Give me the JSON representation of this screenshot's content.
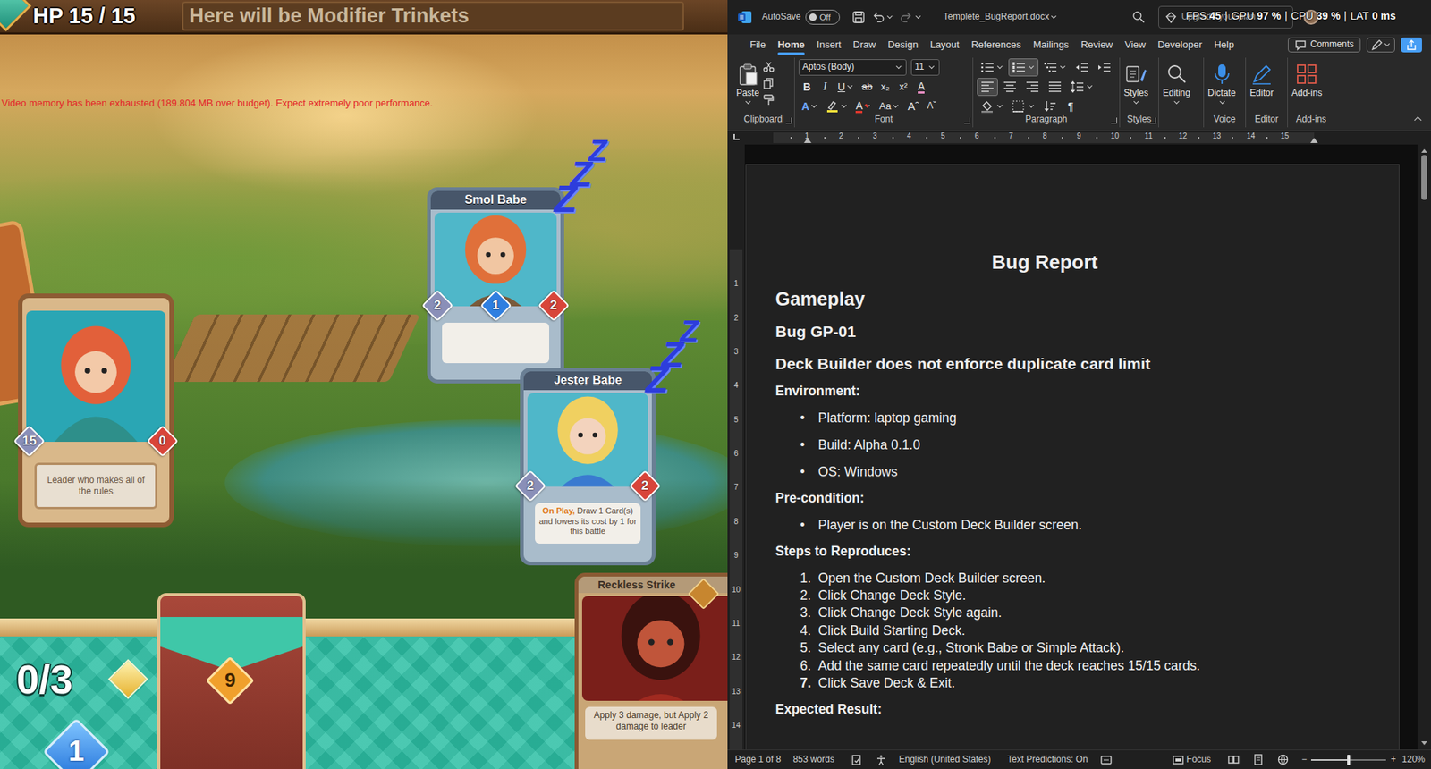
{
  "game": {
    "hp": "HP 15 / 15",
    "trinkets": "Here will be Modifier Trinkets",
    "warning": "Video memory has been exhausted (189.804 MB over budget). Expect extremely poor performance.",
    "leader": {
      "left": "15",
      "right": "0",
      "text": "Leader who makes all of the rules"
    },
    "board": [
      {
        "name": "Smol Babe",
        "left": "2",
        "cost": "1",
        "right": "2",
        "asleep": true
      },
      {
        "name": "Jester Babe",
        "left": "2",
        "right": "2",
        "keyword": "On Play,",
        "text": "Draw 1 Card(s) and lowers its cost by 1 for this battle",
        "asleep": true
      }
    ],
    "sleep_icon": "Z",
    "hand_card": {
      "name": "Reckless Strike",
      "text": "Apply 3 damage, but Apply 2 damage to leader"
    },
    "mana": "0/3",
    "deck_count": "9",
    "energy": "1"
  },
  "word": {
    "title_bar": {
      "autosave": "AutoSave",
      "autosave_state": "Off",
      "autosave_on": false,
      "filename": "Templete_BugReport.docx",
      "upgrade": "Upgrade your plan"
    },
    "overlay": {
      "separator": "|",
      "items": [
        {
          "label": "FPS",
          "value": "45"
        },
        {
          "label": "GPU",
          "value": "97 %"
        },
        {
          "label": "CPU",
          "value": "39 %"
        },
        {
          "label": "LAT",
          "value": "0 ms"
        }
      ]
    },
    "tabs": [
      {
        "label": "File",
        "selected": false
      },
      {
        "label": "Home",
        "selected": true
      },
      {
        "label": "Insert",
        "selected": false
      },
      {
        "label": "Draw",
        "selected": false
      },
      {
        "label": "Design",
        "selected": false
      },
      {
        "label": "Layout",
        "selected": false
      },
      {
        "label": "References",
        "selected": false
      },
      {
        "label": "Mailings",
        "selected": false
      },
      {
        "label": "Review",
        "selected": false
      },
      {
        "label": "View",
        "selected": false
      },
      {
        "label": "Developer",
        "selected": false
      },
      {
        "label": "Help",
        "selected": false
      }
    ],
    "comments": "Comments",
    "ribbon": {
      "clipboard": {
        "paste": "Paste",
        "label": "Clipboard"
      },
      "font": {
        "name": "Aptos (Body)",
        "size": "11",
        "label": "Font",
        "format": [
          {
            "kind": "bold",
            "label": "B"
          },
          {
            "kind": "italic",
            "label": "I"
          },
          {
            "kind": "underline",
            "label": "U"
          },
          {
            "kind": "strike",
            "label": "ab"
          },
          {
            "kind": "sub",
            "label": "x₂"
          },
          {
            "kind": "sup",
            "label": "x²"
          },
          {
            "kind": "clear",
            "label": "A"
          }
        ],
        "effects": [
          {
            "kind": "effects",
            "label": "A"
          },
          {
            "kind": "highlight"
          },
          {
            "kind": "color",
            "label": "A"
          },
          {
            "kind": "case",
            "label": "Aa"
          },
          {
            "kind": "grow",
            "label": "Aˆ"
          },
          {
            "kind": "shrink",
            "label": "Aˇ"
          }
        ]
      },
      "paragraph": {
        "label": "Paragraph",
        "rows": [
          [
            {
              "kind": "bullets",
              "selected": false
            },
            {
              "kind": "numbering",
              "selected": true
            },
            {
              "kind": "multilevel",
              "selected": false
            },
            {
              "kind": "outdent",
              "selected": false
            },
            {
              "kind": "indent",
              "selected": false
            }
          ],
          [
            {
              "kind": "align-left",
              "selected": true
            },
            {
              "kind": "align-center",
              "selected": false
            },
            {
              "kind": "align-right",
              "selected": false
            },
            {
              "kind": "justify",
              "selected": false
            },
            {
              "kind": "line-spacing",
              "selected": false
            }
          ],
          [
            {
              "kind": "shading",
              "selected": false
            },
            {
              "kind": "borders",
              "selected": false
            },
            {
              "kind": "sort",
              "selected": false
            },
            {
              "kind": "marks",
              "label": "¶",
              "selected": false
            }
          ]
        ]
      },
      "styles": {
        "button": "Styles",
        "label": "Styles"
      },
      "editing": {
        "button": "Editing"
      },
      "voice": {
        "button": "Dictate",
        "label": "Voice"
      },
      "editor": {
        "button": "Editor",
        "label": "Editor"
      },
      "addins": {
        "button": "Add-ins",
        "label": "Add-ins"
      }
    },
    "ruler": {
      "horizontal": [
        "1",
        "2",
        "3",
        "4",
        "5",
        "6",
        "7",
        "8",
        "9",
        "10",
        "11",
        "12",
        "13",
        "14",
        "15"
      ],
      "vertical": [
        "1",
        "2",
        "3",
        "4",
        "5",
        "6",
        "7",
        "8",
        "9",
        "10",
        "11",
        "12",
        "13",
        "14"
      ]
    },
    "document": {
      "title": "Bug Report",
      "section": "Gameplay",
      "bug_id": "Bug GP-01",
      "bug_title": "Deck Builder does not enforce duplicate card limit",
      "bullet": "•",
      "environment_label": "Environment:",
      "environment": [
        "Platform: laptop gaming",
        "Build: Alpha 0.1.0",
        "OS: Windows"
      ],
      "precondition_label": "Pre-condition:",
      "precondition": [
        "Player is on the Custom Deck Builder screen."
      ],
      "steps_label": "Steps to Reproduces:",
      "steps": [
        {
          "number": "1.",
          "text": "Open the Custom Deck Builder screen.",
          "bold": false
        },
        {
          "number": "2.",
          "text": "Click Change Deck Style.",
          "bold": false
        },
        {
          "number": "3.",
          "text": "Click Change Deck Style again.",
          "bold": false
        },
        {
          "number": "4.",
          "text": "Click Build Starting Deck.",
          "bold": false
        },
        {
          "number": "5.",
          "text": "Select any card (e.g., Stronk Babe or Simple Attack).",
          "bold": false
        },
        {
          "number": "6.",
          "text": "Add the same card repeatedly until the deck reaches 15/15 cards.",
          "bold": false
        },
        {
          "number": "7.",
          "text": "Click Save Deck & Exit.",
          "bold": true
        }
      ],
      "expected_label": "Expected Result:"
    },
    "status_bar": {
      "page": "Page 1 of 8",
      "words": "853 words",
      "language": "English (United States)",
      "predictions": "Text Predictions: On",
      "focus": "Focus",
      "zoom_minus": "−",
      "zoom_plus": "+",
      "zoom": "120%",
      "zoom_level": 0.5
    }
  }
}
